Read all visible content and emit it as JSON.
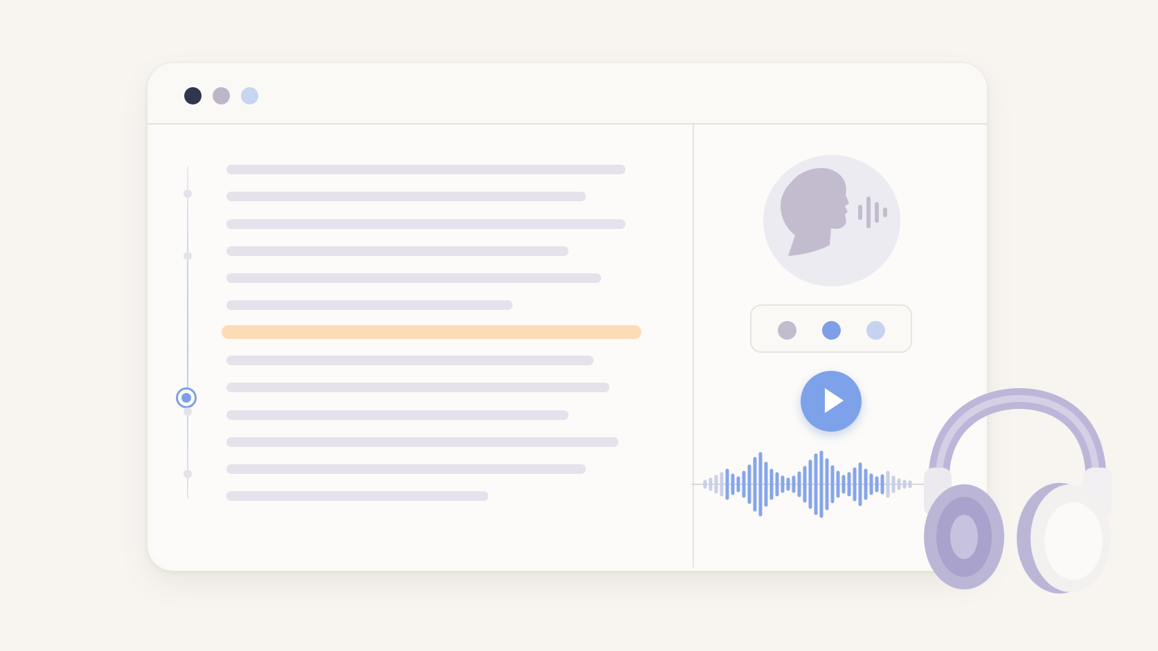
{
  "window": {
    "controls": [
      "close",
      "minimize",
      "maximize"
    ]
  },
  "transcript": {
    "line_count": 13,
    "highlighted_line": 7,
    "timeline_markers": 5
  },
  "speaker": {
    "icon": "speaking-head-icon"
  },
  "voice_selector": {
    "options": 3,
    "selected": 2
  },
  "player": {
    "icon": "play-icon"
  },
  "decor": {
    "icon": "headphones-icon"
  },
  "colors": {
    "accent": "#7ea2e9",
    "highlight": "#fddbb6",
    "text_line": "#e6e2ec",
    "background": "#f8f5f1"
  }
}
